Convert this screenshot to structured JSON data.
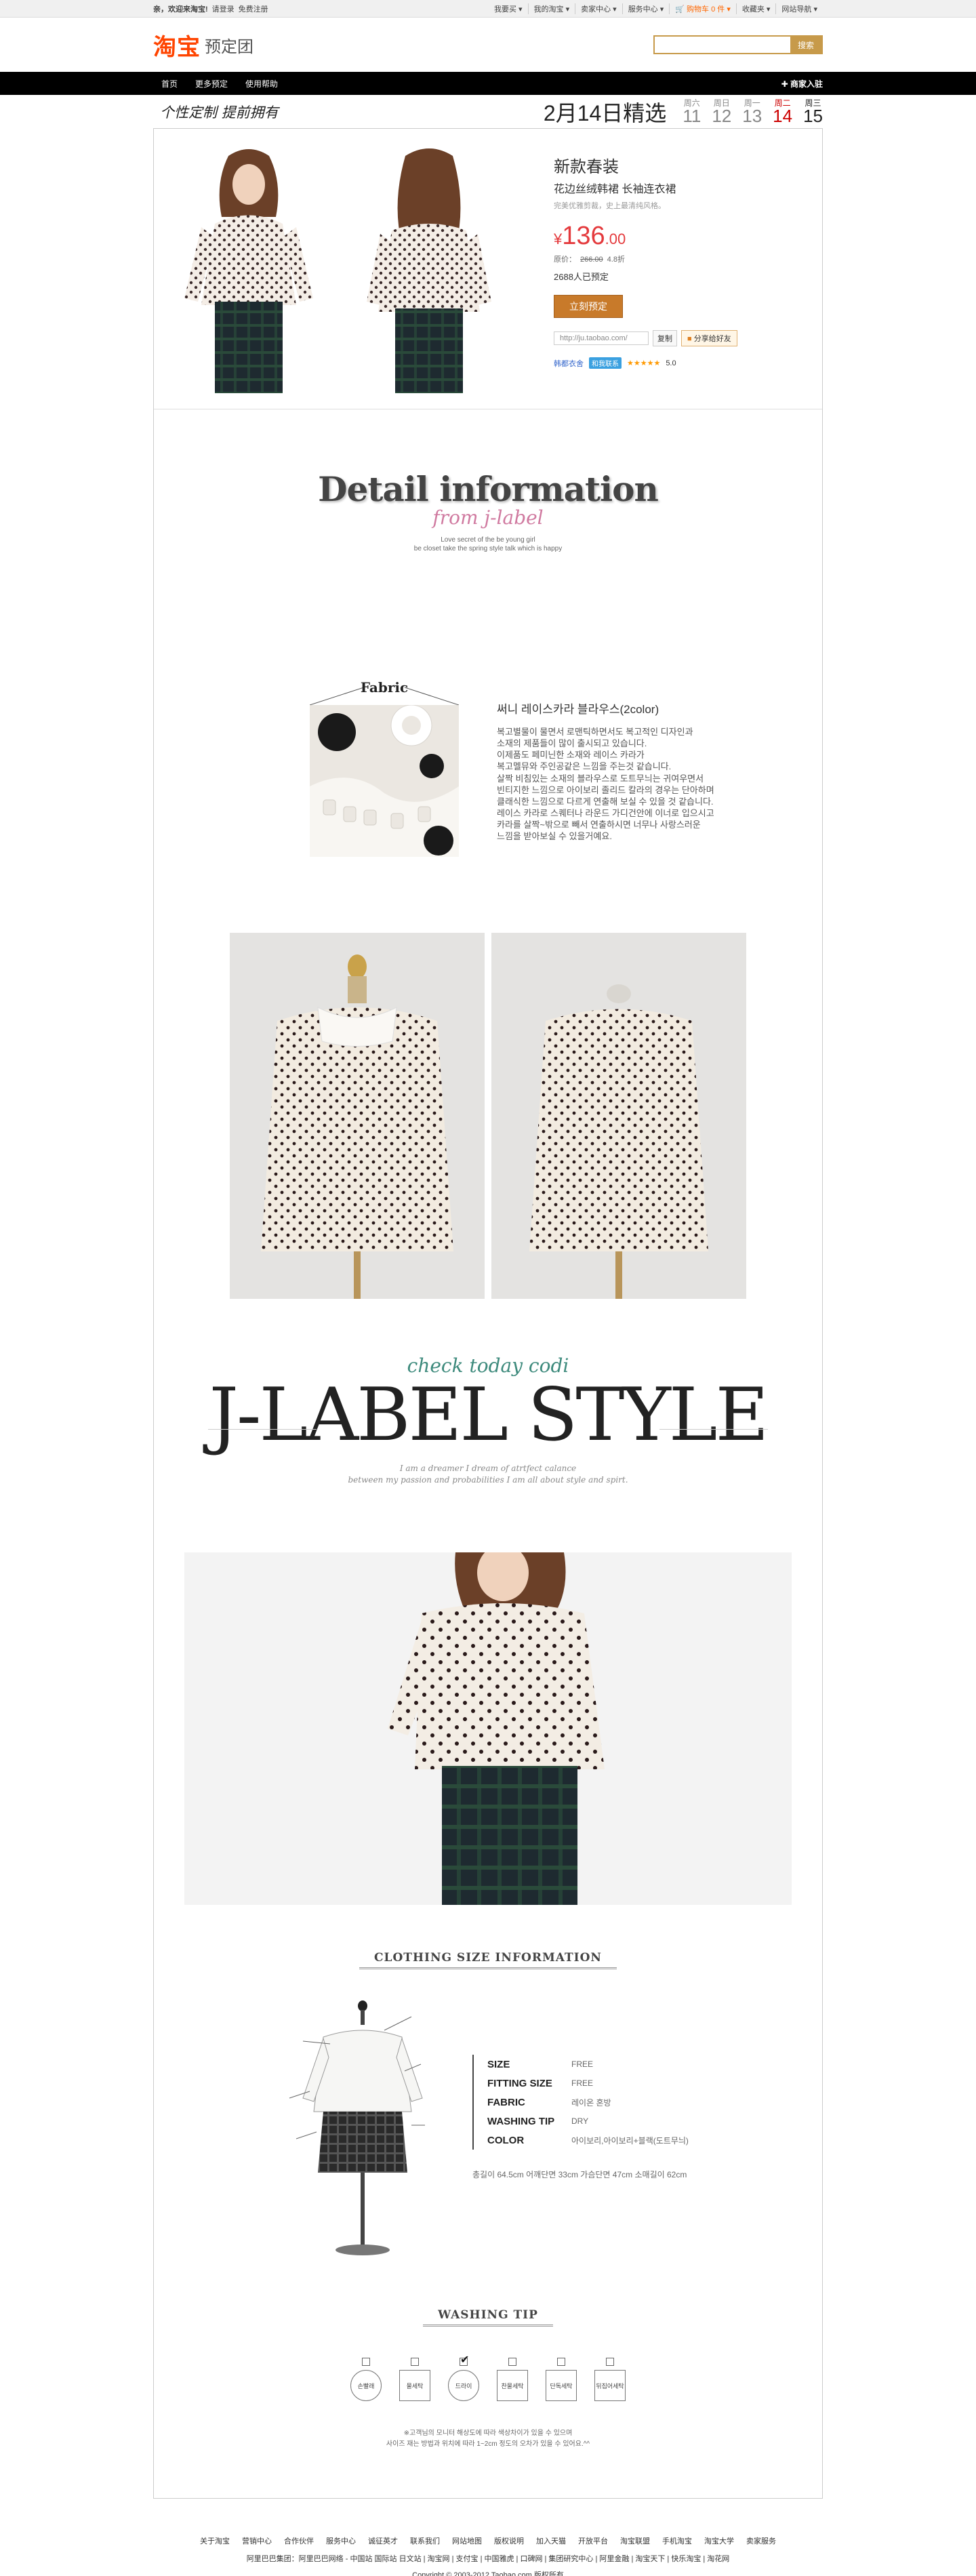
{
  "topbar": {
    "welcome": "亲，欢迎来淘宝!",
    "login": "请登录",
    "register": "免费注册",
    "links": [
      "我要买 ▾",
      "我的淘宝 ▾",
      "卖家中心 ▾",
      "服务中心 ▾",
      "购物车 0 件 ▾",
      "收藏夹 ▾",
      "网站导航 ▾"
    ]
  },
  "header": {
    "logo_mark": "淘宝",
    "logo_sub": "预定团",
    "search_placeholder": "",
    "search_button": "搜索"
  },
  "nav": {
    "links": [
      "首页",
      "更多预定",
      "使用帮助"
    ],
    "join": "✚ 商家入驻"
  },
  "daterow": {
    "slogan": "个性定制  提前拥有",
    "title": "2月14日精选",
    "days": [
      {
        "week": "周六",
        "num": "11"
      },
      {
        "week": "周日",
        "num": "12"
      },
      {
        "week": "周一",
        "num": "13"
      },
      {
        "week": "周二",
        "num": "14"
      },
      {
        "week": "周三",
        "num": "15"
      }
    ]
  },
  "product": {
    "title": "新款春装",
    "subtitle": "花边丝绒韩裙 长袖连衣裙",
    "desc": "完美优雅剪裁，史上最清纯风格。",
    "price_symbol": "¥",
    "price_int": "136",
    "price_dec": ".00",
    "orig_label": "原价：",
    "orig_price": "266.00",
    "discount": "4.8折",
    "sold": "2688人已预定",
    "buy_label": "立刻预定",
    "share_url": "http://ju.taobao.com/",
    "copy_label": "复制",
    "fav_label": "分享给好友",
    "shop_name": "韩都衣舍",
    "wangwang": "和我联系",
    "rating": "5.0"
  },
  "detail": {
    "title": "Detail information",
    "subtitle": "from j-label",
    "note1": "Love secret of the be young girl",
    "note2": "be closet take the spring style talk which is happy"
  },
  "fabric": {
    "label": "Fabric",
    "heading": "써니 레이스카라 블라우스(2color)",
    "lines": [
      "복고별물이 물면서 로맨틱하면서도 복고적인 디자인과",
      "소재의 제품들이 많이 출시되고 있습니다.",
      "이제품도 페미닌한 소재와 레이스 카라가",
      "복고멜뮤와 주인공같은 느낌을 주는것 같습니다.",
      "살짝 비침있는 소재의 블라우스로 도트무늬는 귀여우면서",
      "빈티지한 느낌으로 아이보리 졸리드 칼라의 경우는 단아하며",
      "클래식한 느낌으로 다르게 연출해 보실 수 있을 것 같습니다.",
      "레이스 카라로 스퀘터나 라운드 가디건안에 이너로 입으시고",
      "카라를 살짝~밖으로 빼서 연출하시면 너무나 사랑스러운",
      "느낌을 받아보실 수 있을거예요."
    ]
  },
  "jlabel": {
    "subtitle": "check today codi",
    "title": "J-LABEL STYLE",
    "note1": "I am a dreamer I dream of atrtfect calance",
    "note2": "between my passion and probabilities I am all about style and spirt."
  },
  "size": {
    "heading": "CLOTHING SIZE INFORMATION",
    "rows": [
      {
        "k": "SIZE",
        "v": "FREE"
      },
      {
        "k": "FITTING SIZE",
        "v": "FREE"
      },
      {
        "k": "FABRIC",
        "v": "레이온 혼방"
      },
      {
        "k": "WASHING TIP",
        "v": "DRY"
      },
      {
        "k": "COLOR",
        "v": "아이보리,아이보리+블랙(도트무늬)"
      }
    ],
    "measure": "총길이 64.5cm   어깨단면 33cm   가슴단면 47cm   소매길이 62cm"
  },
  "washing": {
    "heading": "WASHING TIP",
    "icons": [
      "손빨래",
      "물세탁",
      "드라이",
      "찬물세탁",
      "단독세탁",
      "뒤집어세탁"
    ],
    "note1": "※고객님의 모니터 해상도에 따라 색상차이가 있을 수 있으며",
    "note2": "사이즈 재는 방법과 위치에 따라 1~2cm 정도의 오차가 있을 수 있어요.^^"
  },
  "footer": {
    "links": [
      "关于淘宝",
      "营销中心",
      "合作伙伴",
      "服务中心",
      "诚征英才",
      "联系我们",
      "网站地图",
      "版权说明",
      "加入天猫",
      "开放平台",
      "淘宝联盟",
      "手机淘宝",
      "淘宝大学",
      "卖家服务"
    ],
    "group": "阿里巴巴集团：阿里巴巴网络 - 中国站  国际站  日文站 | 淘宝网 | 支付宝 | 中国雅虎 | 口碑网 | 集团研究中心 | 阿里金融 | 淘宝天下 | 快乐淘宝 | 淘花网",
    "copyright": "Copyright © 2003-2012 Taobao.com 版权所有"
  }
}
